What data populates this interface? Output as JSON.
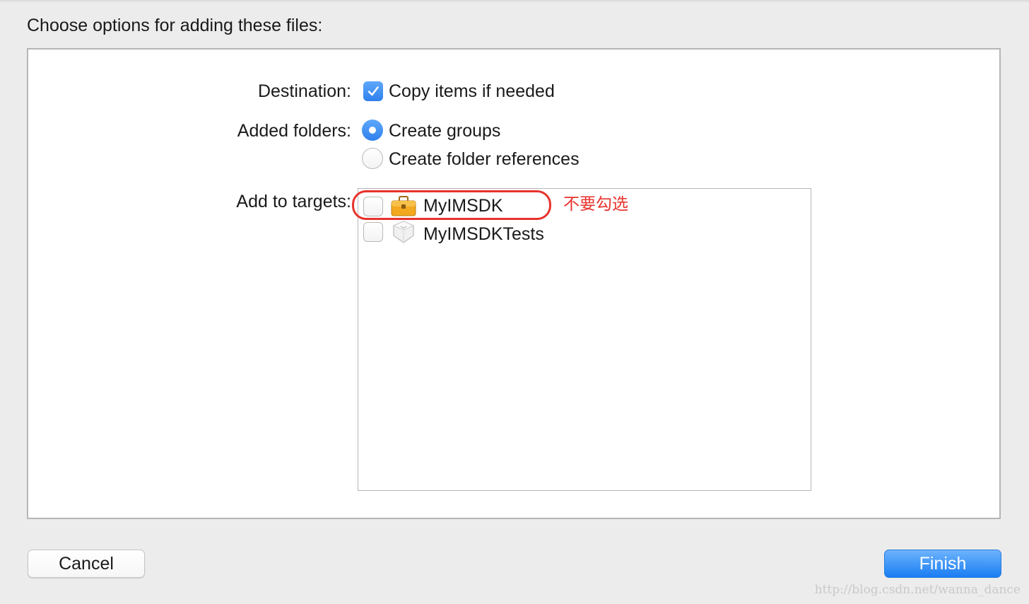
{
  "heading": "Choose options for adding these files:",
  "destination": {
    "label": "Destination:",
    "copy_items": {
      "label": "Copy items if needed",
      "checked": true
    }
  },
  "added_folders": {
    "label": "Added folders:",
    "options": [
      {
        "label": "Create groups",
        "selected": true
      },
      {
        "label": "Create folder references",
        "selected": false
      }
    ]
  },
  "add_to_targets": {
    "label": "Add to targets:",
    "targets": [
      {
        "name": "MyIMSDK",
        "checked": false,
        "icon": "toolbox-icon"
      },
      {
        "name": "MyIMSDKTests",
        "checked": false,
        "icon": "test-bundle-icon"
      }
    ]
  },
  "annotation": {
    "text": "不要勾选",
    "color": "#e8322c"
  },
  "buttons": {
    "cancel": "Cancel",
    "finish": "Finish"
  },
  "watermark": "http://blog.csdn.net/wanna_dance",
  "colors": {
    "accent": "#2f80ed",
    "annotation_red": "#e8322c"
  }
}
